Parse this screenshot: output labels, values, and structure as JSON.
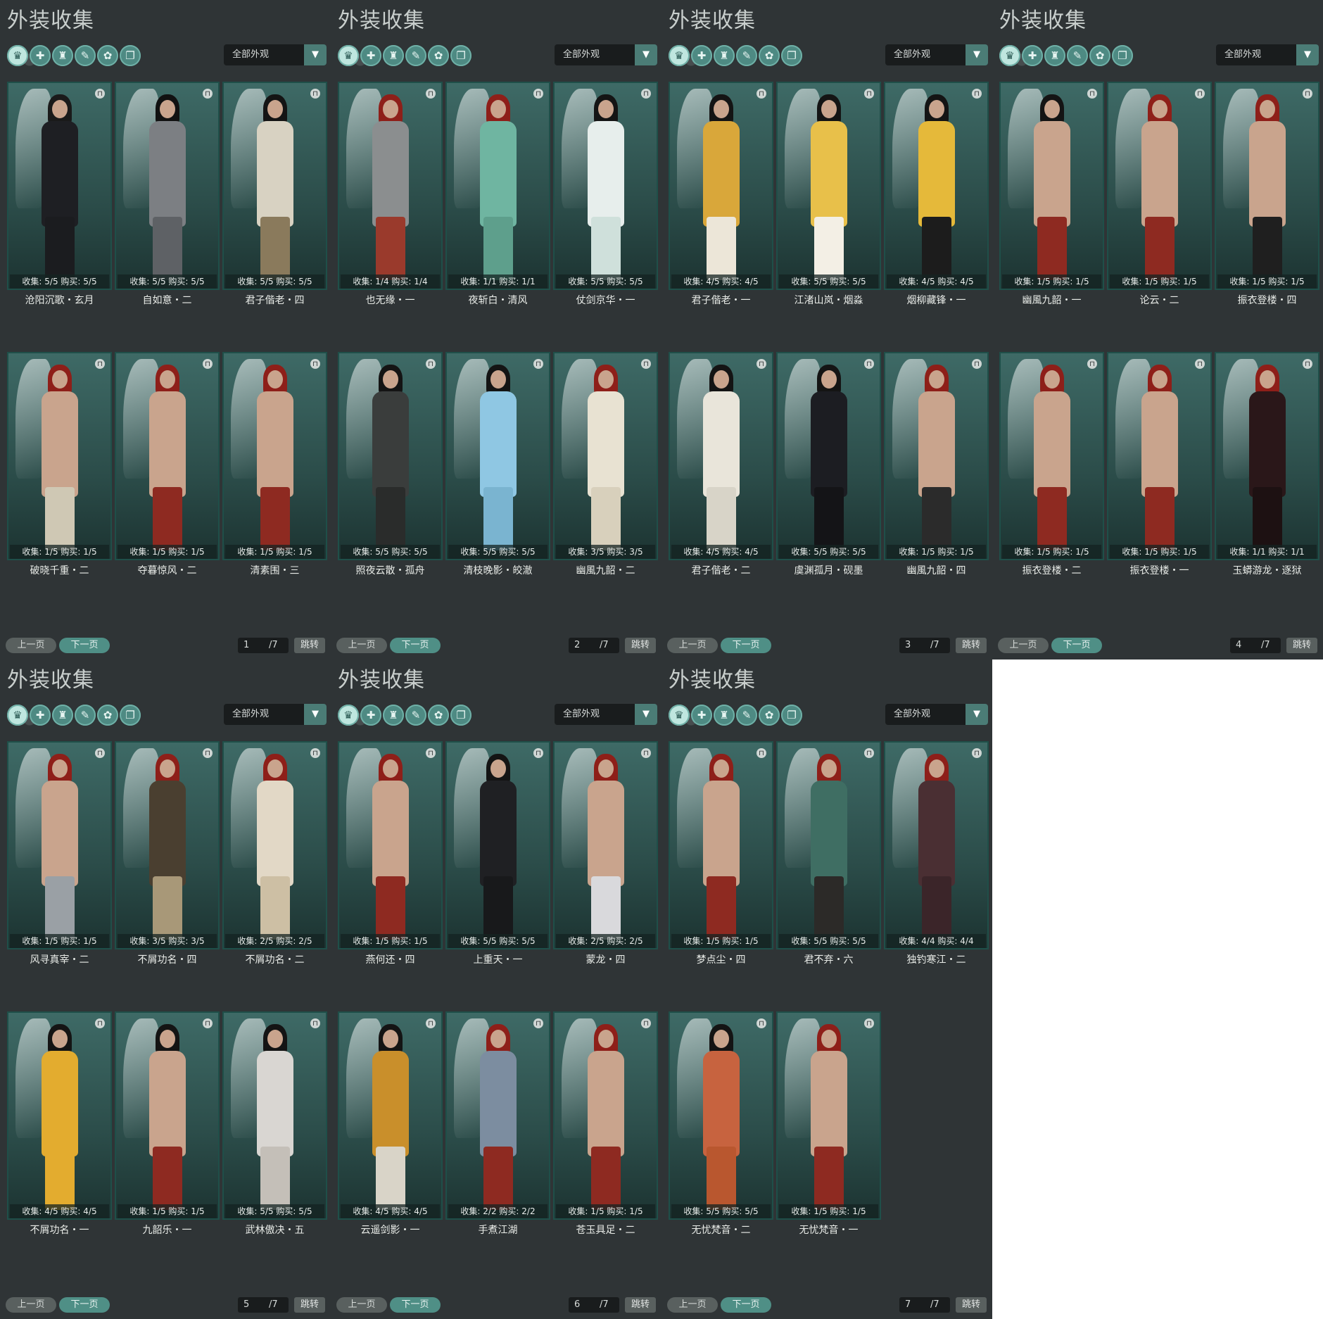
{
  "title": "外装收集",
  "filter": "全部外观",
  "prev_label": "上一页",
  "next_label": "下一页",
  "jump_label": "跳转",
  "total_pages": "/7",
  "category_icons": [
    "outfit-all-icon",
    "outfit-top-icon",
    "outfit-robe-icon",
    "outfit-shoe-icon",
    "outfit-mask-icon",
    "outfit-misc-icon"
  ],
  "pages": [
    {
      "page": "1",
      "items": [
        {
          "stats": "收集: 5/5  购买: 5/5",
          "name": "沧阳沉歌・玄月",
          "body": "#1e1f23",
          "legs": "#1b1c1f",
          "hair": "#1a1a1a"
        },
        {
          "stats": "收集: 5/5  购买: 5/5",
          "name": "自如意・二",
          "body": "#7c7f83",
          "legs": "#5e6165",
          "hair": "#111111"
        },
        {
          "stats": "收集: 5/5  购买: 5/5",
          "name": "君子偕老・四",
          "body": "#d8d2c2",
          "legs": "#8a7a5c",
          "hair": "#141414"
        },
        {
          "stats": "收集: 1/5  购买: 1/5",
          "name": "破晓千重・二",
          "body": "#c9a48d",
          "legs": "#cfc8b4",
          "hair": "#8e1f19"
        },
        {
          "stats": "收集: 1/5  购买: 1/5",
          "name": "夺暮惊风・二",
          "body": "#c9a48d",
          "legs": "#8e2a21",
          "hair": "#8e1f19"
        },
        {
          "stats": "收集: 1/5  购买: 1/5",
          "name": "清素围・三",
          "body": "#c9a48d",
          "legs": "#8e2a21",
          "hair": "#8e1f19"
        }
      ]
    },
    {
      "page": "2",
      "items": [
        {
          "stats": "收集: 1/4  购买: 1/4",
          "name": "也无缘・一",
          "body": "#8b8e8f",
          "legs": "#9a3a2c",
          "hair": "#8e1f19"
        },
        {
          "stats": "收集: 1/1  购买: 1/1",
          "name": "夜斩白・清风",
          "body": "#6fb5a1",
          "legs": "#5e9f8c",
          "hair": "#8e1f19"
        },
        {
          "stats": "收集: 5/5  购买: 5/5",
          "name": "仗剑京华・一",
          "body": "#e7eeec",
          "legs": "#cfe0db",
          "hair": "#141414"
        },
        {
          "stats": "收集: 5/5  购买: 5/5",
          "name": "照夜云散・孤舟",
          "body": "#3a3d3c",
          "legs": "#2a2c2b",
          "hair": "#141414"
        },
        {
          "stats": "收集: 5/5  购买: 5/5",
          "name": "清枝晚影・皎澈",
          "body": "#8fc7e3",
          "legs": "#7ab4d0",
          "hair": "#141414"
        },
        {
          "stats": "收集: 3/5  购买: 3/5",
          "name": "幽風九韶・二",
          "body": "#e8e2d2",
          "legs": "#d8d0bc",
          "hair": "#8e1f19"
        }
      ]
    },
    {
      "page": "3",
      "items": [
        {
          "stats": "收集: 4/5  购买: 4/5",
          "name": "君子偕老・一",
          "body": "#d9a73a",
          "legs": "#ece6d8",
          "hair": "#141414"
        },
        {
          "stats": "收集: 5/5  购买: 5/5",
          "name": "江渚山岚・烟淼",
          "body": "#e8c04a",
          "legs": "#f3efe5",
          "hair": "#141414"
        },
        {
          "stats": "收集: 4/5  购买: 4/5",
          "name": "烟柳藏锋・一",
          "body": "#e5b93a",
          "legs": "#1c1c1c",
          "hair": "#141414"
        },
        {
          "stats": "收集: 4/5  购买: 4/5",
          "name": "君子偕老・二",
          "body": "#e9e5da",
          "legs": "#d8d4c8",
          "hair": "#141414"
        },
        {
          "stats": "收集: 5/5  购买: 5/5",
          "name": "虞渊孤月・砚墨",
          "body": "#1c1d22",
          "legs": "#141417",
          "hair": "#141414"
        },
        {
          "stats": "收集: 1/5  购买: 1/5",
          "name": "幽風九韶・四",
          "body": "#c9a48d",
          "legs": "#2b2b2b",
          "hair": "#8e1f19"
        }
      ]
    },
    {
      "page": "4",
      "items": [
        {
          "stats": "收集: 1/5  购买: 1/5",
          "name": "幽風九韶・一",
          "body": "#c9a48d",
          "legs": "#8e2a21",
          "hair": "#141414"
        },
        {
          "stats": "收集: 1/5  购买: 1/5",
          "name": "论云・二",
          "body": "#c9a48d",
          "legs": "#8e2a21",
          "hair": "#8e1f19"
        },
        {
          "stats": "收集: 1/5  购买: 1/5",
          "name": "振衣登楼・四",
          "body": "#c9a48d",
          "legs": "#1f1f1f",
          "hair": "#8e1f19"
        },
        {
          "stats": "收集: 1/5  购买: 1/5",
          "name": "振衣登楼・二",
          "body": "#c9a48d",
          "legs": "#8e2a21",
          "hair": "#8e1f19"
        },
        {
          "stats": "收集: 1/5  购买: 1/5",
          "name": "振衣登楼・一",
          "body": "#c9a48d",
          "legs": "#8e2a21",
          "hair": "#8e1f19"
        },
        {
          "stats": "收集: 1/1  购买: 1/1",
          "name": "玉蟒游龙・逐狱",
          "body": "#2a1719",
          "legs": "#1d1112",
          "hair": "#8e1f19"
        }
      ]
    },
    {
      "page": "5",
      "items": [
        {
          "stats": "收集: 1/5  购买: 1/5",
          "name": "风寻真宰・二",
          "body": "#c9a48d",
          "legs": "#9aa0a5",
          "hair": "#8e1f19"
        },
        {
          "stats": "收集: 3/5  购买: 3/5",
          "name": "不屑功名・四",
          "body": "#4a3f30",
          "legs": "#a89878",
          "hair": "#8e1f19"
        },
        {
          "stats": "收集: 2/5  购买: 2/5",
          "name": "不屑功名・二",
          "body": "#e2d8c6",
          "legs": "#cdbfa4",
          "hair": "#8e1f19"
        },
        {
          "stats": "收集: 4/5  购买: 4/5",
          "name": "不屑功名・一",
          "body": "#e3ac2f",
          "legs": "#e3ac2f",
          "hair": "#141414"
        },
        {
          "stats": "收集: 1/5  购买: 1/5",
          "name": "九韶乐・一",
          "body": "#c9a48d",
          "legs": "#8e2a21",
          "hair": "#141414"
        },
        {
          "stats": "收集: 5/5  购买: 5/5",
          "name": "武林傲决・五",
          "body": "#d9d6d2",
          "legs": "#c4bfb8",
          "hair": "#141414"
        }
      ]
    },
    {
      "page": "6",
      "items": [
        {
          "stats": "收集: 1/5  购买: 1/5",
          "name": "燕何还・四",
          "body": "#c9a48d",
          "legs": "#8e2a21",
          "hair": "#8e1f19"
        },
        {
          "stats": "收集: 5/5  购买: 5/5",
          "name": "上重天・一",
          "body": "#1f2023",
          "legs": "#18191b",
          "hair": "#141414"
        },
        {
          "stats": "收集: 2/5  购买: 2/5",
          "name": "蒙龙・四",
          "body": "#c9a48d",
          "legs": "#d9d9dc",
          "hair": "#8e1f19"
        },
        {
          "stats": "收集: 4/5  购买: 4/5",
          "name": "云遥剑影・一",
          "body": "#c98f2b",
          "legs": "#d9d4c8",
          "hair": "#141414"
        },
        {
          "stats": "收集: 2/2  购买: 2/2",
          "name": "手煮江湖",
          "body": "#7c8da0",
          "legs": "#8e2a21",
          "hair": "#8e1f19"
        },
        {
          "stats": "收集: 1/5  购买: 1/5",
          "name": "苍玉具足・二",
          "body": "#c9a48d",
          "legs": "#8e2a21",
          "hair": "#8e1f19"
        }
      ]
    },
    {
      "page": "7",
      "items": [
        {
          "stats": "收集: 1/5  购买: 1/5",
          "name": "梦点尘・四",
          "body": "#c9a48d",
          "legs": "#8e2a21",
          "hair": "#8e1f19"
        },
        {
          "stats": "收集: 5/5  购买: 5/5",
          "name": "君不弃・六",
          "body": "#3f6e63",
          "legs": "#2c2a28",
          "hair": "#8e1f19"
        },
        {
          "stats": "收集: 4/4  购买: 4/4",
          "name": "独钓寒江・二",
          "body": "#4a2f33",
          "legs": "#3b2529",
          "hair": "#8e1f19"
        },
        {
          "stats": "收集: 5/5  购买: 5/5",
          "name": "无忧梵音・二",
          "body": "#c7633f",
          "legs": "#b9572f",
          "hair": "#141414"
        },
        {
          "stats": "收集: 1/5  购买: 1/5",
          "name": "无忧梵音・一",
          "body": "#c9a48d",
          "legs": "#8e2a21",
          "hair": "#8e1f19"
        }
      ]
    }
  ]
}
